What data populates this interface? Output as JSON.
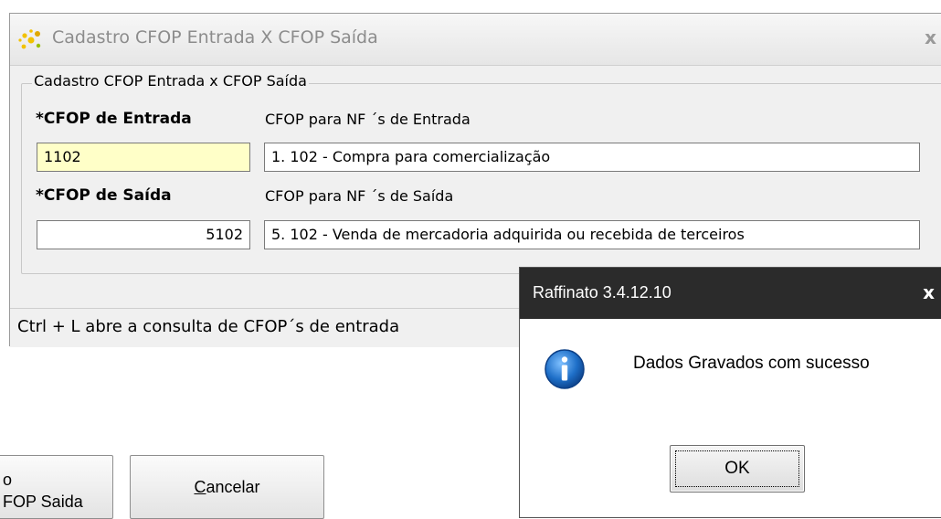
{
  "main_window": {
    "title": "Cadastro CFOP Entrada X CFOP Saída",
    "close_glyph": "x",
    "app_icon": "sparkle-app-icon",
    "group_title": "Cadastro CFOP Entrada x CFOP Saída",
    "entrada": {
      "label": "*CFOP de Entrada",
      "desc_label": "CFOP para NF ´s de Entrada",
      "code_value": "1102",
      "desc_value": "1. 102 - Compra para comercialização"
    },
    "saida": {
      "label": "*CFOP de Saída",
      "desc_label": "CFOP para NF ´s de Saída",
      "code_value": "5102",
      "desc_value": "5. 102 - Venda de mercadoria adquirida ou recebida de terceiros"
    },
    "status_text": "Ctrl + L abre a consulta de CFOP´s de entrada"
  },
  "bottom_buttons": {
    "partial_line1": "o",
    "partial_line2": "FOP Saida",
    "cancel_prefix": "",
    "cancel_mnemonic": "C",
    "cancel_rest": "ancelar"
  },
  "dialog": {
    "title": "Raffinato 3.4.12.10",
    "close_glyph": "x",
    "message": "Dados Gravados com sucesso",
    "ok_label": "OK",
    "icon": "info-icon"
  },
  "colors": {
    "focused_field": "#ffffc8",
    "dialog_titlebar": "#2b2b2b",
    "info_icon": "#1e6fc8"
  }
}
